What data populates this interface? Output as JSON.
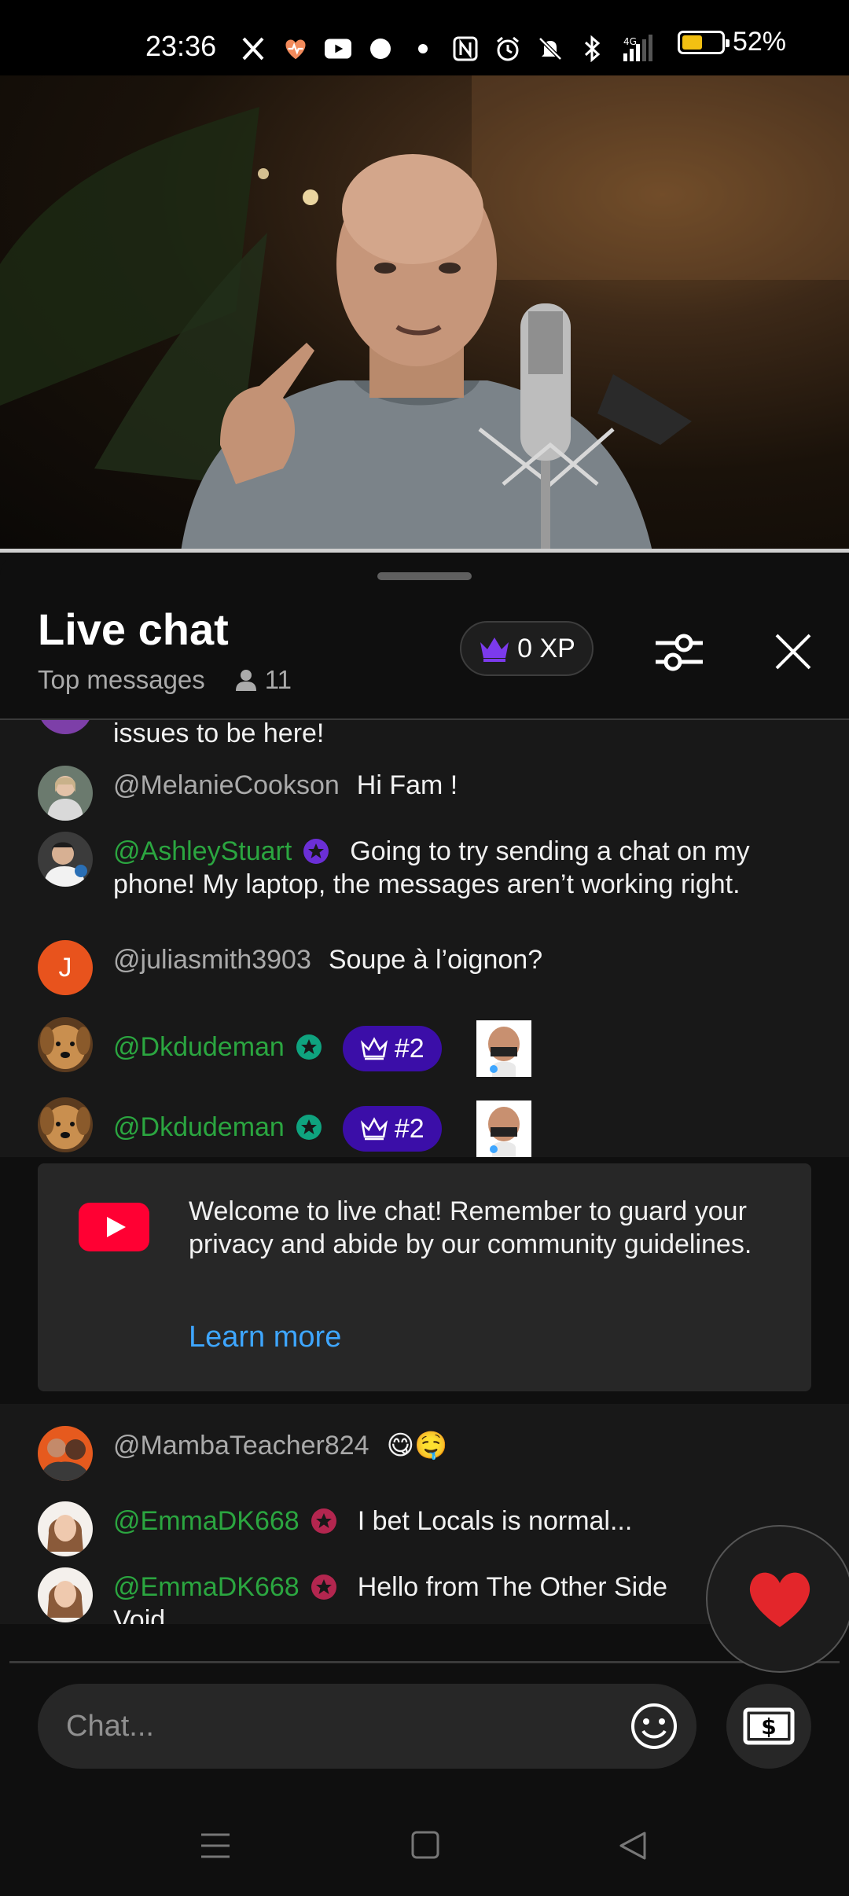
{
  "status_bar": {
    "time": "23:36",
    "icons": [
      "x-icon",
      "heart-icon",
      "youtube-icon",
      "circle-icon",
      "dot-icon",
      "nfc-icon",
      "alarm-icon",
      "mute-icon",
      "bluetooth-icon",
      "signal-4g-icon"
    ],
    "signal_label": "4G",
    "battery_level": 0.52,
    "battery_text": "52%"
  },
  "video": {
    "progress": 1.0
  },
  "chat": {
    "title": "Live chat",
    "mode": "Top messages",
    "viewer_count": "11",
    "xp": "0 XP",
    "messages": [
      {
        "text": "issues to be here!"
      },
      {
        "author": "@MelanieCookson",
        "text": "Hi Fam !"
      },
      {
        "author": "@AshleyStuart",
        "text": "Going to try sending a chat on my phone! My laptop, the messages aren’t working right."
      },
      {
        "author": "@juliasmith3903",
        "avatar_letter": "J",
        "text": "Soupe à l’oignon?"
      },
      {
        "author": "@Dkdudeman",
        "rank": "#2"
      },
      {
        "author": "@Dkdudeman",
        "rank": "#2"
      },
      {
        "author": "@MambaTeacher824",
        "text": "😋🤤"
      },
      {
        "author": "@EmmaDK668",
        "text": "I bet Locals is normal..."
      },
      {
        "author": "@EmmaDK668",
        "text": "Hello from The Other Side",
        "text_line2": "Void"
      }
    ],
    "welcome": {
      "text": "Welcome to live chat! Remember to guard your privacy and abide by our community guidelines.",
      "link": "Learn more"
    },
    "input_placeholder": "Chat..."
  },
  "colors": {
    "member_name": "#2ba640",
    "link": "#3ea6ff",
    "rank_pill": "#3b0ea8",
    "crown": "#7c3aed",
    "battery": "#f2c012"
  }
}
